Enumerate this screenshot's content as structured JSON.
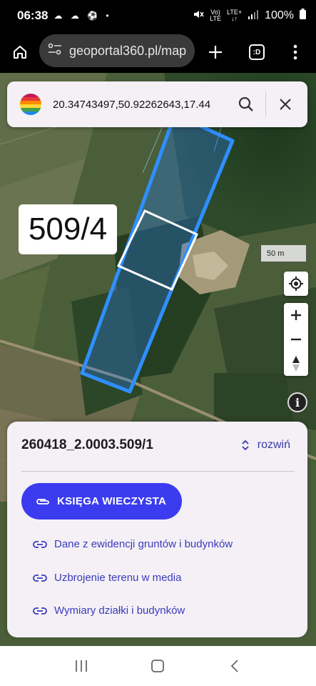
{
  "status": {
    "time": "06:38",
    "left_icons": "☁ ☁ ⚽ •",
    "volte_top": "Vo)",
    "volte_bottom": "LTE",
    "lte_top": "LTE+",
    "lte_bottom": "↓↑",
    "battery": "100%"
  },
  "browser": {
    "url": "geoportal360.pl/map",
    "tab_label": ":D"
  },
  "search": {
    "value": "20.34743497,50.92262643,17.44"
  },
  "map": {
    "parcel_label": "509/4",
    "scale_label": "50 m",
    "info_label": "i"
  },
  "panel": {
    "parcel_id": "260418_2.0003.509/1",
    "expand_label": "rozwiń",
    "kw_button": "KSIĘGA WIECZYSTA",
    "links": [
      "Dane z ewidencji gruntów i budynków",
      "Uzbrojenie terenu w media",
      "Wymiary działki i budynków"
    ]
  },
  "colors": {
    "accent": "#3b3cf0",
    "link": "#3a3bbd",
    "parcel_outline": "#2f8fff",
    "panel_bg": "#f4f0f6"
  }
}
